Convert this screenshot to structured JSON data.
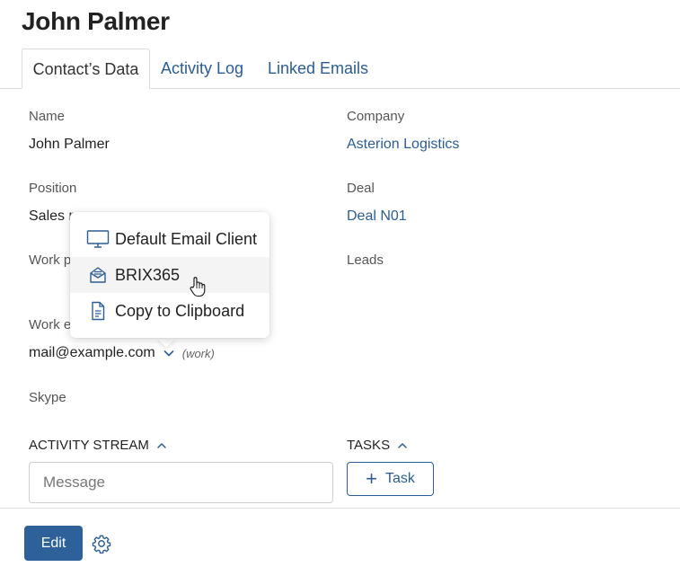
{
  "header": {
    "title": "John Palmer"
  },
  "tabs": [
    {
      "label": "Contact’s Data"
    },
    {
      "label": "Activity Log"
    },
    {
      "label": "Linked Emails"
    }
  ],
  "fields": {
    "name": {
      "label": "Name",
      "value": "John Palmer"
    },
    "company": {
      "label": "Company",
      "value": "Asterion Logistics"
    },
    "position": {
      "label": "Position",
      "value": "Sales m"
    },
    "deal": {
      "label": "Deal",
      "value": "Deal N01"
    },
    "work_phone": {
      "label": "Work p"
    },
    "leads": {
      "label": "Leads"
    },
    "work_email": {
      "label": "Work e",
      "value": "mail@example.com",
      "tag": "(work)"
    },
    "skype": {
      "label": "Skype"
    }
  },
  "activity_stream": {
    "label": "ACTIVITY STREAM",
    "message_placeholder": "Message"
  },
  "tasks": {
    "label": "TASKS",
    "button_label": "Task"
  },
  "footer": {
    "edit_label": "Edit"
  },
  "email_menu": {
    "items": [
      {
        "label": "Default Email Client",
        "icon": "monitor-icon"
      },
      {
        "label": "BRIX365",
        "icon": "mail-envelope-icon"
      },
      {
        "label": "Copy to Clipboard",
        "icon": "document-icon"
      }
    ]
  },
  "colors": {
    "link": "#2a5d96",
    "primary_button": "#2e6199"
  }
}
